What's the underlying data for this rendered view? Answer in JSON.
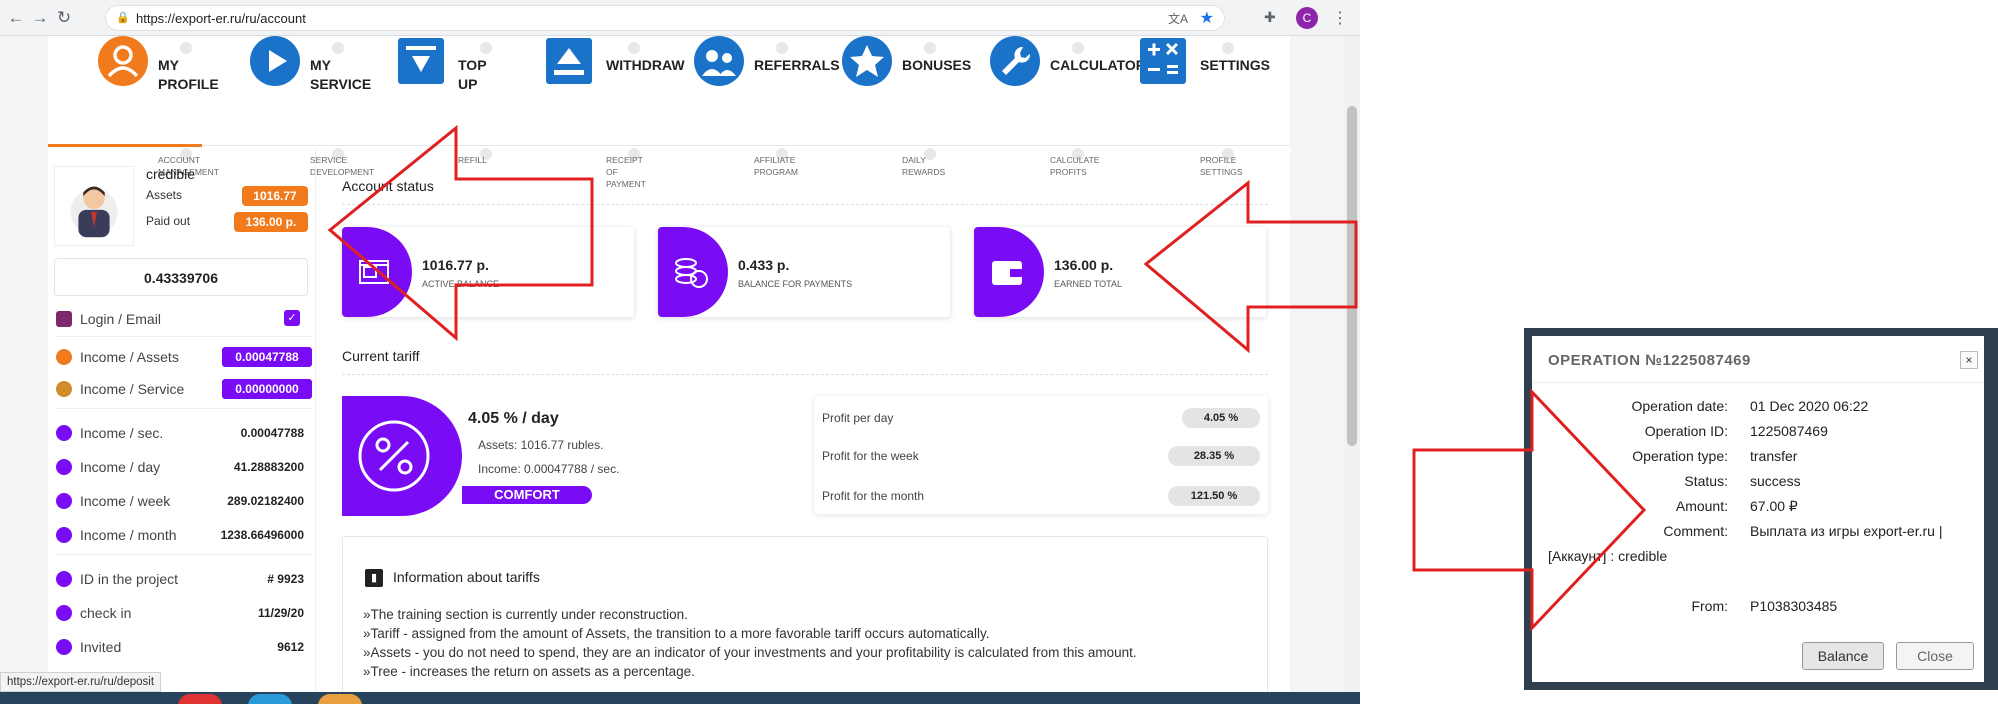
{
  "browser": {
    "url": "https://export-er.ru/ru/account",
    "profile_initial": "C",
    "status_url": "https://export-er.ru/ru/deposit"
  },
  "menu": {
    "items": [
      {
        "label": "MY\nPROFILE",
        "sub": "ACCOUNT\nMANAGEMENT",
        "icon": "user-icon",
        "color": "#f07a1c"
      },
      {
        "label": "MY\nSERVICE",
        "sub": "SERVICE\nDEVELOPMENT",
        "icon": "play-icon",
        "color": "#1a73c8"
      },
      {
        "label": "TOP\nUP",
        "sub": "REFILL",
        "icon": "download-icon",
        "color": "#1a73c8"
      },
      {
        "label": "WITHDRAW",
        "sub": "RECEIPT\nOF\nPAYMENT",
        "icon": "upload-icon",
        "color": "#1a73c8"
      },
      {
        "label": "REFERRALS",
        "sub": "AFFILIATE\nPROGRAM",
        "icon": "users-icon",
        "color": "#1a73c8"
      },
      {
        "label": "BONUSES",
        "sub": "DAILY\nREWARDS",
        "icon": "star-icon",
        "color": "#1a73c8"
      },
      {
        "label": "CALCULATOR",
        "sub": "CALCULATE\nPROFITS",
        "icon": "wrench-icon",
        "color": "#1a73c8"
      },
      {
        "label": "SETTINGS",
        "sub": "PROFILE\nSETTINGS",
        "icon": "calculator-icon",
        "color": "#1a73c8"
      }
    ]
  },
  "profile": {
    "name": "credible",
    "assets_label": "Assets",
    "assets_value": "1016.77",
    "paid_label": "Paid out",
    "paid_value": "136.00 р.",
    "balance": "0.43339706"
  },
  "sidebar": {
    "login_label": "Login / Email",
    "rows": [
      {
        "label": "Income / Assets",
        "value": "0.00047788"
      },
      {
        "label": "Income / Service",
        "value": "0.00000000"
      },
      {
        "label": "Income / sec.",
        "value": "0.00047788"
      },
      {
        "label": "Income / day",
        "value": "41.28883200"
      },
      {
        "label": "Income / week",
        "value": "289.02182400"
      },
      {
        "label": "Income / month",
        "value": "1238.66496000"
      },
      {
        "label": "ID in the project",
        "value": "# 9923"
      },
      {
        "label": "check in",
        "value": "11/29/20"
      },
      {
        "label": "Invited",
        "value": "9612"
      }
    ]
  },
  "account_status": {
    "title": "Account status",
    "cards": [
      {
        "value": "1016.77 р.",
        "label": "ACTIVE BALANCE"
      },
      {
        "value": "0.433 р.",
        "label": "BALANCE FOR PAYMENTS"
      },
      {
        "value": "136.00 р.",
        "label": "EARNED TOTAL"
      }
    ]
  },
  "tariff": {
    "title": "Current tariff",
    "rate": "4.05 % / day",
    "assets_line": "Assets: 1016.77 rubles.",
    "income_line": "Income: 0.00047788 / sec.",
    "badge": "COMFORT",
    "profit": [
      {
        "label": "Profit per day",
        "value": "4.05 %"
      },
      {
        "label": "Profit for the week",
        "value": "28.35 %"
      },
      {
        "label": "Profit for the month",
        "value": "121.50 %"
      }
    ]
  },
  "info": {
    "title": "Information about tariffs",
    "lines": [
      "»The training section is currently under reconstruction.",
      "»Tariff - assigned from the amount of Assets, the transition to a more favorable tariff occurs automatically.",
      "»Assets - you do not need to spend, they are an indicator of your investments and your profitability is calculated from this amount.",
      "»Tree - increases the return on assets as a percentage."
    ]
  },
  "dialog": {
    "title": "OPERATION №1225087469",
    "close_glyph": "×",
    "rows": [
      {
        "key": "Operation date:",
        "value": "01 Dec 2020 06:22"
      },
      {
        "key": "Operation ID:",
        "value": "1225087469"
      },
      {
        "key": "Operation type:",
        "value": "transfer"
      },
      {
        "key": "Status:",
        "value": "success"
      },
      {
        "key": "Amount:",
        "value": "67.00 ₽"
      },
      {
        "key": "Comment:",
        "value": "Выплата из игры export-er.ru |"
      }
    ],
    "comment_cont": "[Аккаунт] : credible",
    "from_key": "From:",
    "from_value": "P1038303485",
    "balance_btn": "Balance",
    "close_btn": "Close"
  },
  "colors": {
    "accent_purple": "#7a0cf5",
    "accent_orange": "#f07a1c",
    "annotation_red": "#e02020"
  }
}
